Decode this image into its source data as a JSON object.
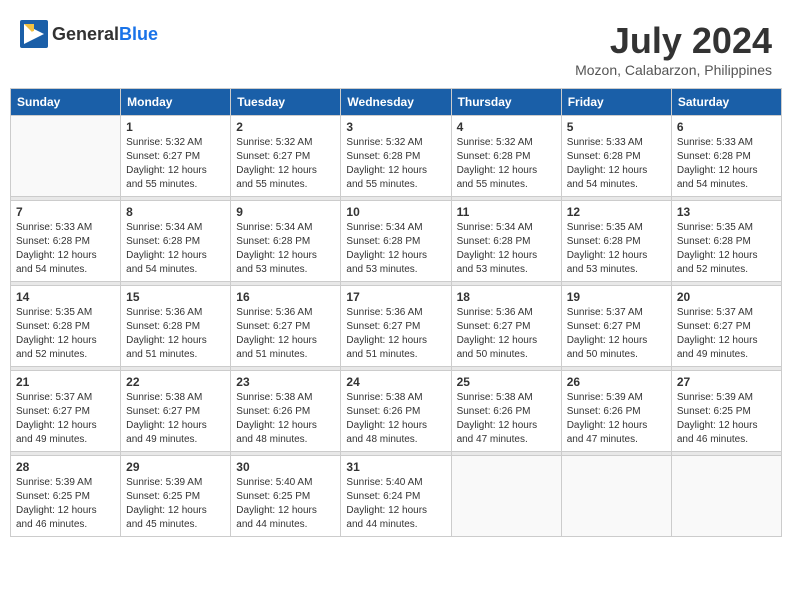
{
  "header": {
    "logo_general": "General",
    "logo_blue": "Blue",
    "month": "July 2024",
    "location": "Mozon, Calabarzon, Philippines"
  },
  "weekdays": [
    "Sunday",
    "Monday",
    "Tuesday",
    "Wednesday",
    "Thursday",
    "Friday",
    "Saturday"
  ],
  "weeks": [
    [
      {
        "day": "",
        "sunrise": "",
        "sunset": "",
        "daylight": ""
      },
      {
        "day": "1",
        "sunrise": "Sunrise: 5:32 AM",
        "sunset": "Sunset: 6:27 PM",
        "daylight": "Daylight: 12 hours and 55 minutes."
      },
      {
        "day": "2",
        "sunrise": "Sunrise: 5:32 AM",
        "sunset": "Sunset: 6:27 PM",
        "daylight": "Daylight: 12 hours and 55 minutes."
      },
      {
        "day": "3",
        "sunrise": "Sunrise: 5:32 AM",
        "sunset": "Sunset: 6:28 PM",
        "daylight": "Daylight: 12 hours and 55 minutes."
      },
      {
        "day": "4",
        "sunrise": "Sunrise: 5:32 AM",
        "sunset": "Sunset: 6:28 PM",
        "daylight": "Daylight: 12 hours and 55 minutes."
      },
      {
        "day": "5",
        "sunrise": "Sunrise: 5:33 AM",
        "sunset": "Sunset: 6:28 PM",
        "daylight": "Daylight: 12 hours and 54 minutes."
      },
      {
        "day": "6",
        "sunrise": "Sunrise: 5:33 AM",
        "sunset": "Sunset: 6:28 PM",
        "daylight": "Daylight: 12 hours and 54 minutes."
      }
    ],
    [
      {
        "day": "7",
        "sunrise": "Sunrise: 5:33 AM",
        "sunset": "Sunset: 6:28 PM",
        "daylight": "Daylight: 12 hours and 54 minutes."
      },
      {
        "day": "8",
        "sunrise": "Sunrise: 5:34 AM",
        "sunset": "Sunset: 6:28 PM",
        "daylight": "Daylight: 12 hours and 54 minutes."
      },
      {
        "day": "9",
        "sunrise": "Sunrise: 5:34 AM",
        "sunset": "Sunset: 6:28 PM",
        "daylight": "Daylight: 12 hours and 53 minutes."
      },
      {
        "day": "10",
        "sunrise": "Sunrise: 5:34 AM",
        "sunset": "Sunset: 6:28 PM",
        "daylight": "Daylight: 12 hours and 53 minutes."
      },
      {
        "day": "11",
        "sunrise": "Sunrise: 5:34 AM",
        "sunset": "Sunset: 6:28 PM",
        "daylight": "Daylight: 12 hours and 53 minutes."
      },
      {
        "day": "12",
        "sunrise": "Sunrise: 5:35 AM",
        "sunset": "Sunset: 6:28 PM",
        "daylight": "Daylight: 12 hours and 53 minutes."
      },
      {
        "day": "13",
        "sunrise": "Sunrise: 5:35 AM",
        "sunset": "Sunset: 6:28 PM",
        "daylight": "Daylight: 12 hours and 52 minutes."
      }
    ],
    [
      {
        "day": "14",
        "sunrise": "Sunrise: 5:35 AM",
        "sunset": "Sunset: 6:28 PM",
        "daylight": "Daylight: 12 hours and 52 minutes."
      },
      {
        "day": "15",
        "sunrise": "Sunrise: 5:36 AM",
        "sunset": "Sunset: 6:28 PM",
        "daylight": "Daylight: 12 hours and 51 minutes."
      },
      {
        "day": "16",
        "sunrise": "Sunrise: 5:36 AM",
        "sunset": "Sunset: 6:27 PM",
        "daylight": "Daylight: 12 hours and 51 minutes."
      },
      {
        "day": "17",
        "sunrise": "Sunrise: 5:36 AM",
        "sunset": "Sunset: 6:27 PM",
        "daylight": "Daylight: 12 hours and 51 minutes."
      },
      {
        "day": "18",
        "sunrise": "Sunrise: 5:36 AM",
        "sunset": "Sunset: 6:27 PM",
        "daylight": "Daylight: 12 hours and 50 minutes."
      },
      {
        "day": "19",
        "sunrise": "Sunrise: 5:37 AM",
        "sunset": "Sunset: 6:27 PM",
        "daylight": "Daylight: 12 hours and 50 minutes."
      },
      {
        "day": "20",
        "sunrise": "Sunrise: 5:37 AM",
        "sunset": "Sunset: 6:27 PM",
        "daylight": "Daylight: 12 hours and 49 minutes."
      }
    ],
    [
      {
        "day": "21",
        "sunrise": "Sunrise: 5:37 AM",
        "sunset": "Sunset: 6:27 PM",
        "daylight": "Daylight: 12 hours and 49 minutes."
      },
      {
        "day": "22",
        "sunrise": "Sunrise: 5:38 AM",
        "sunset": "Sunset: 6:27 PM",
        "daylight": "Daylight: 12 hours and 49 minutes."
      },
      {
        "day": "23",
        "sunrise": "Sunrise: 5:38 AM",
        "sunset": "Sunset: 6:26 PM",
        "daylight": "Daylight: 12 hours and 48 minutes."
      },
      {
        "day": "24",
        "sunrise": "Sunrise: 5:38 AM",
        "sunset": "Sunset: 6:26 PM",
        "daylight": "Daylight: 12 hours and 48 minutes."
      },
      {
        "day": "25",
        "sunrise": "Sunrise: 5:38 AM",
        "sunset": "Sunset: 6:26 PM",
        "daylight": "Daylight: 12 hours and 47 minutes."
      },
      {
        "day": "26",
        "sunrise": "Sunrise: 5:39 AM",
        "sunset": "Sunset: 6:26 PM",
        "daylight": "Daylight: 12 hours and 47 minutes."
      },
      {
        "day": "27",
        "sunrise": "Sunrise: 5:39 AM",
        "sunset": "Sunset: 6:25 PM",
        "daylight": "Daylight: 12 hours and 46 minutes."
      }
    ],
    [
      {
        "day": "28",
        "sunrise": "Sunrise: 5:39 AM",
        "sunset": "Sunset: 6:25 PM",
        "daylight": "Daylight: 12 hours and 46 minutes."
      },
      {
        "day": "29",
        "sunrise": "Sunrise: 5:39 AM",
        "sunset": "Sunset: 6:25 PM",
        "daylight": "Daylight: 12 hours and 45 minutes."
      },
      {
        "day": "30",
        "sunrise": "Sunrise: 5:40 AM",
        "sunset": "Sunset: 6:25 PM",
        "daylight": "Daylight: 12 hours and 44 minutes."
      },
      {
        "day": "31",
        "sunrise": "Sunrise: 5:40 AM",
        "sunset": "Sunset: 6:24 PM",
        "daylight": "Daylight: 12 hours and 44 minutes."
      },
      {
        "day": "",
        "sunrise": "",
        "sunset": "",
        "daylight": ""
      },
      {
        "day": "",
        "sunrise": "",
        "sunset": "",
        "daylight": ""
      },
      {
        "day": "",
        "sunrise": "",
        "sunset": "",
        "daylight": ""
      }
    ]
  ]
}
